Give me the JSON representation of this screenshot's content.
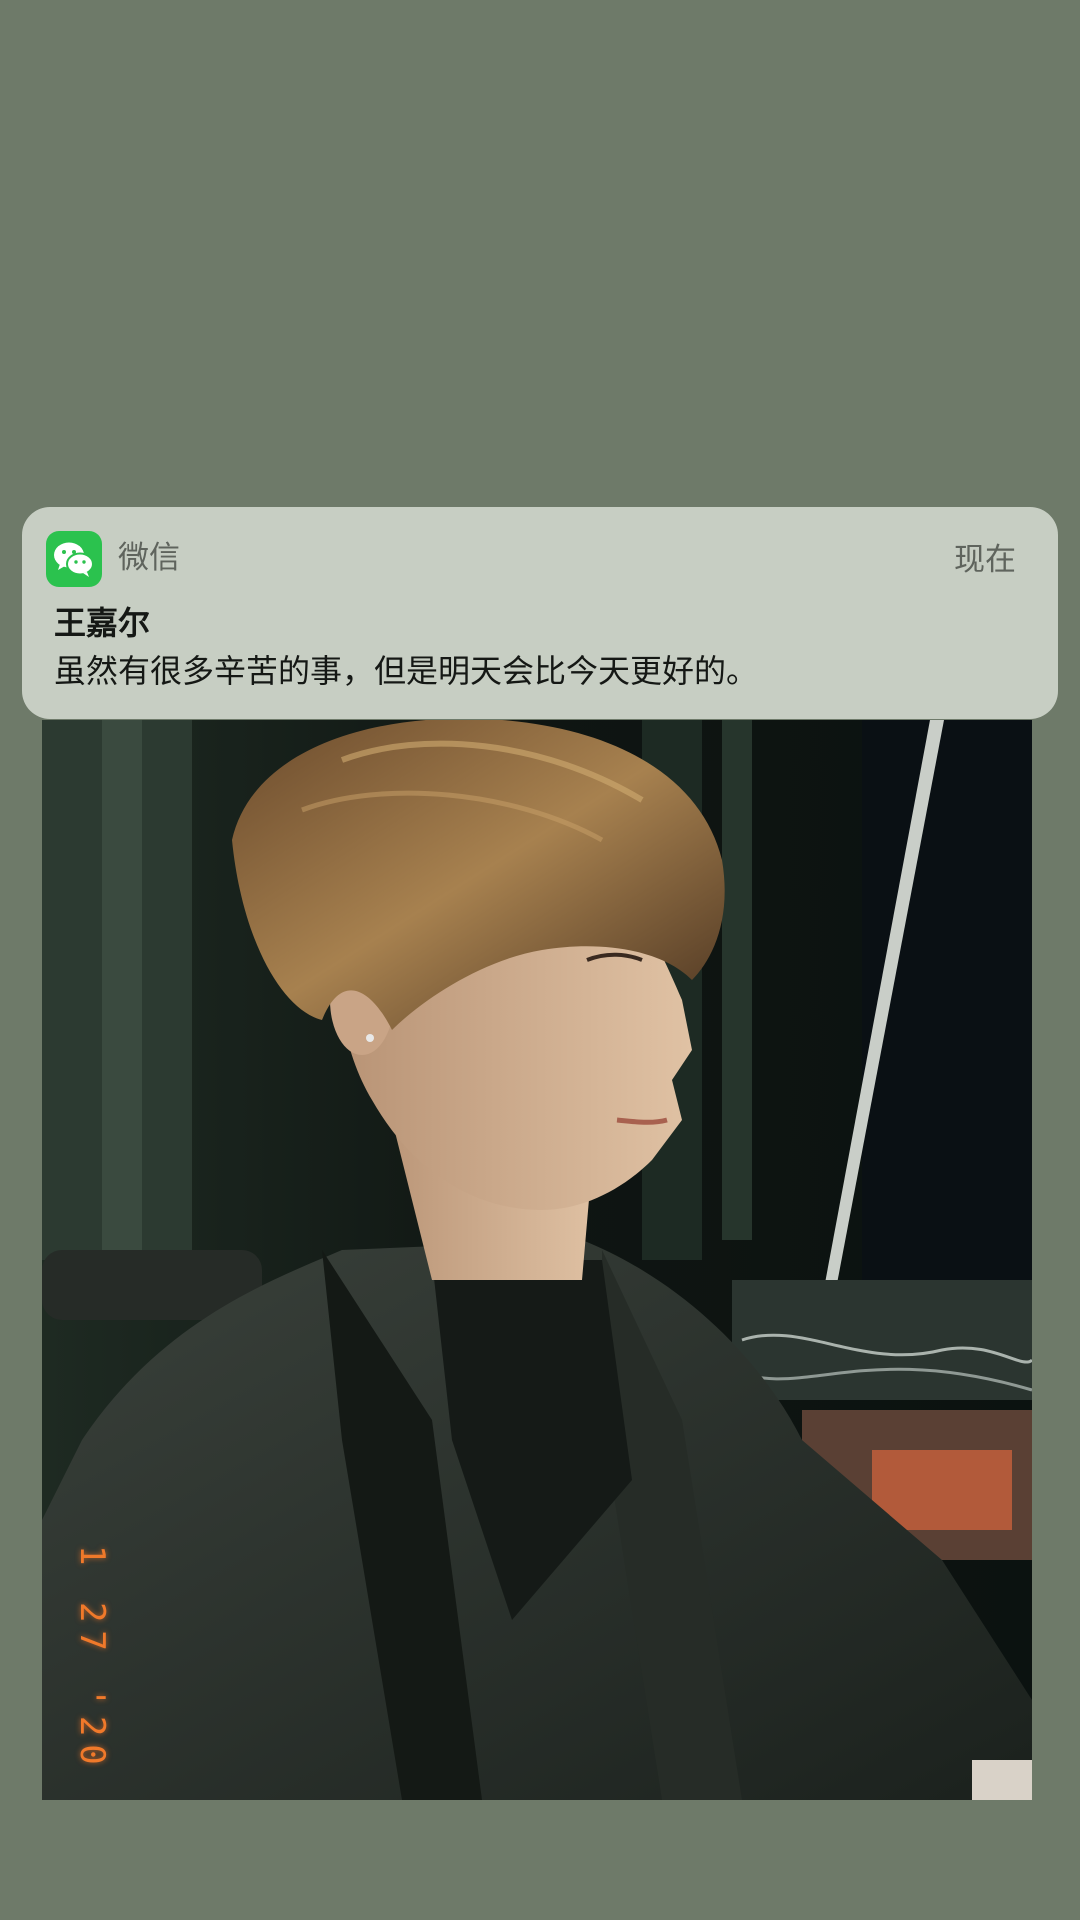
{
  "notification": {
    "app_name": "微信",
    "app_icon": "wechat-icon",
    "timestamp": "现在",
    "sender": "王嘉尔",
    "message": "虽然有很多辛苦的事，但是明天会比今天更好的。"
  },
  "photo": {
    "date_stamp": "1 27 '20"
  },
  "colors": {
    "wallpaper": "#6e7a69",
    "wechat_green": "#2bc24e",
    "date_stamp": "#f0792a"
  }
}
